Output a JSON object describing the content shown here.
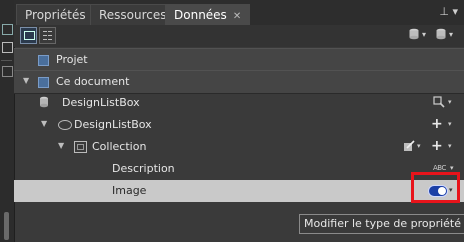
{
  "tabs": [
    {
      "label": "Propriétés"
    },
    {
      "label": "Ressources"
    },
    {
      "label": "Données",
      "active": true
    }
  ],
  "tab_close_glyph": "✕",
  "pin_glyph": "⊥",
  "tree": {
    "projet": "Projet",
    "ce_document": "Ce document",
    "designlistbox_root": "DesignListBox",
    "designlistbox_child": "DesignListBox",
    "collection": "Collection",
    "description": "Description",
    "image": "Image"
  },
  "abc_label": "ABC",
  "tooltip": "Modifier le type de propriété",
  "colors": {
    "highlight": "#e8141b",
    "selected_row": "#c9c9c9",
    "toggle": "#1b3fa6"
  },
  "icons": [
    "window-icon",
    "list-icon",
    "database-icon",
    "magnifier-icon",
    "eye-icon",
    "collection-icon",
    "plus-icon",
    "edit-icon",
    "toggle-icon"
  ]
}
